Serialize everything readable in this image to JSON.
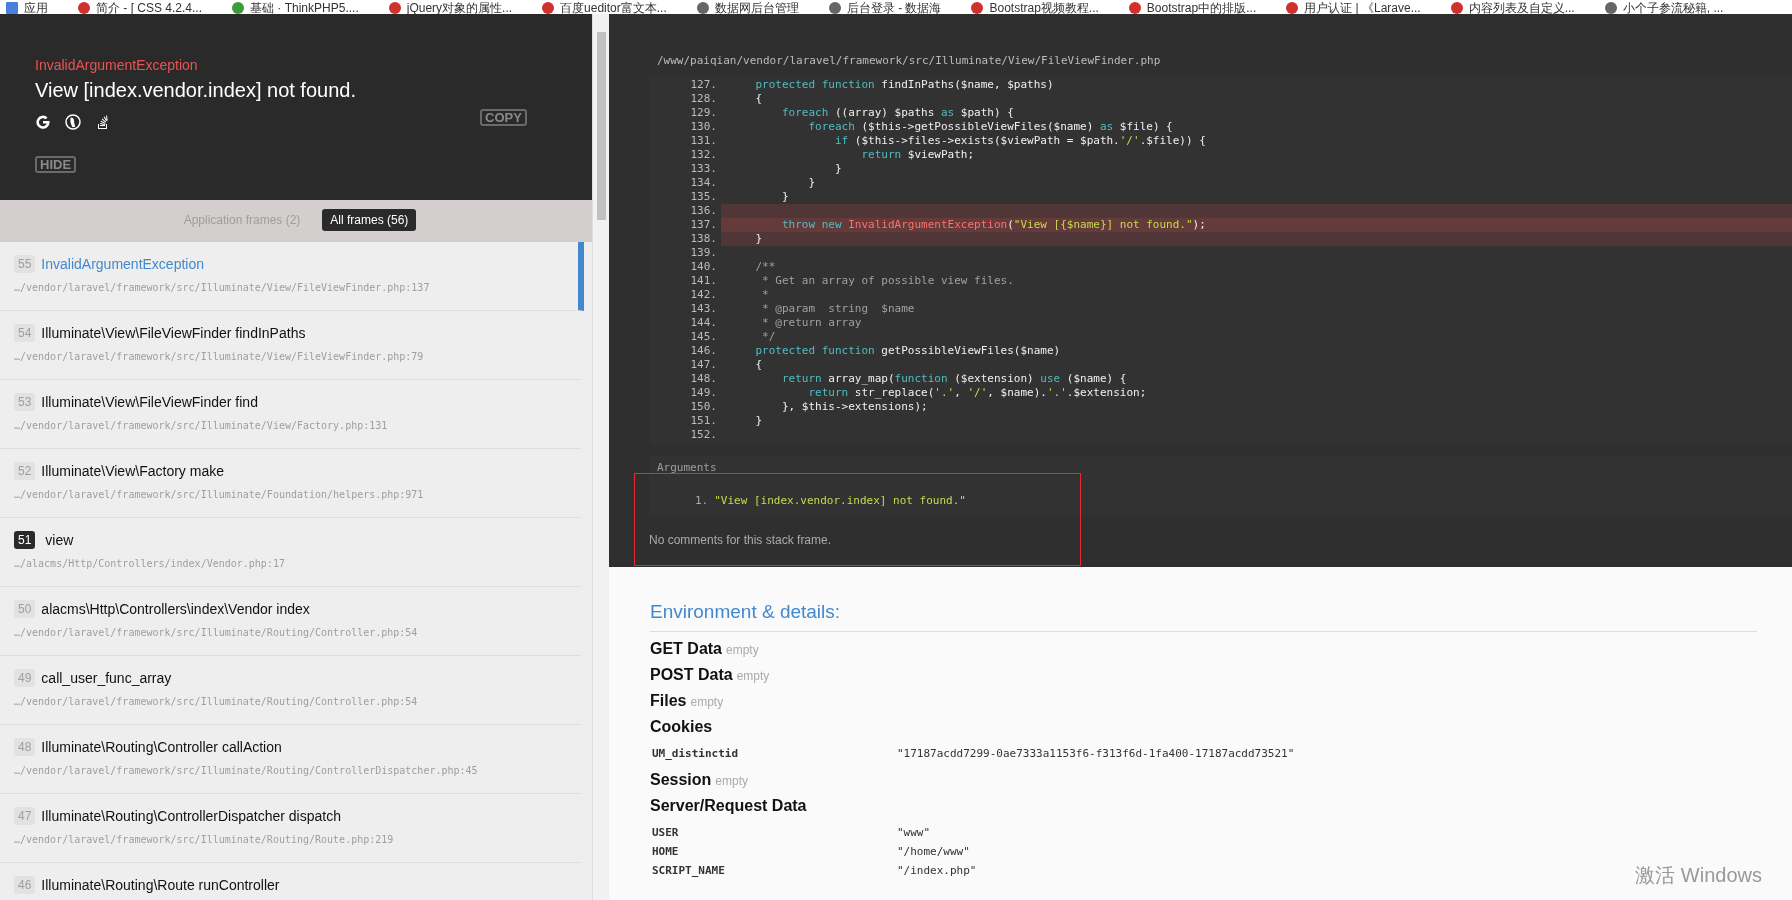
{
  "bookmarks": [
    {
      "label": "应用"
    },
    {
      "label": "简介 - [ CSS 4.2.4..."
    },
    {
      "label": "基础 · ThinkPHP5...."
    },
    {
      "label": "jQuery对象的属性..."
    },
    {
      "label": "百度ueditor富文本..."
    },
    {
      "label": "数据网后台管理"
    },
    {
      "label": "后台登录 - 数据海"
    },
    {
      "label": "Bootstrap视频教程..."
    },
    {
      "label": "Bootstrap中的排版..."
    },
    {
      "label": "用户认证 | 《Larave..."
    },
    {
      "label": "内容列表及自定义..."
    },
    {
      "label": "小个子参流秘籍, ..."
    }
  ],
  "exception": {
    "class": "InvalidArgumentException",
    "message": "View [index.vendor.index] not found.",
    "copy_label": "COPY",
    "hide_label": "HIDE"
  },
  "frame_tabs": [
    {
      "label": "Application frames (2)",
      "selected": false
    },
    {
      "label": "All frames (56)",
      "selected": true
    }
  ],
  "frames": [
    {
      "index": "55",
      "title": "InvalidArgumentException",
      "path": "…/vendor/laravel/framework/src/Illuminate/View/FileViewFinder.php:137",
      "selected": true,
      "application": false
    },
    {
      "index": "54",
      "title": "Illuminate\\View\\FileViewFinder findInPaths",
      "path": "…/vendor/laravel/framework/src/Illuminate/View/FileViewFinder.php:79",
      "selected": false,
      "application": false
    },
    {
      "index": "53",
      "title": "Illuminate\\View\\FileViewFinder find",
      "path": "…/vendor/laravel/framework/src/Illuminate/View/Factory.php:131",
      "selected": false,
      "application": false
    },
    {
      "index": "52",
      "title": "Illuminate\\View\\Factory make",
      "path": "…/vendor/laravel/framework/src/Illuminate/Foundation/helpers.php:971",
      "selected": false,
      "application": false
    },
    {
      "index": "51",
      "title": "view",
      "path": "…/alacms/Http/Controllers/index/Vendor.php:17",
      "selected": false,
      "application": true
    },
    {
      "index": "50",
      "title": "alacms\\Http\\Controllers\\index\\Vendor index",
      "path": "…/vendor/laravel/framework/src/Illuminate/Routing/Controller.php:54",
      "selected": false,
      "application": false
    },
    {
      "index": "49",
      "title": "call_user_func_array",
      "path": "…/vendor/laravel/framework/src/Illuminate/Routing/Controller.php:54",
      "selected": false,
      "application": false
    },
    {
      "index": "48",
      "title": "Illuminate\\Routing\\Controller callAction",
      "path": "…/vendor/laravel/framework/src/Illuminate/Routing/ControllerDispatcher.php:45",
      "selected": false,
      "application": false
    },
    {
      "index": "47",
      "title": "Illuminate\\Routing\\ControllerDispatcher dispatch",
      "path": "…/vendor/laravel/framework/src/Illuminate/Routing/Route.php:219",
      "selected": false,
      "application": false
    },
    {
      "index": "46",
      "title": "Illuminate\\Routing\\Route runController",
      "selected": false,
      "application": false
    }
  ],
  "code": {
    "file": "/www/paiqian/vendor/laravel/framework/src/Illuminate/View/FileViewFinder.php",
    "lines": [
      {
        "number": "127.",
        "highlighted": false,
        "error": false,
        "tokens": [
          {
            "kind": "kw",
            "text": "    protected function"
          },
          {
            "kind": "plain",
            "text": " findInPaths($name, $paths)"
          }
        ]
      },
      {
        "number": "128.",
        "highlighted": false,
        "error": false,
        "tokens": [
          {
            "kind": "plain",
            "text": "    {"
          }
        ]
      },
      {
        "number": "129.",
        "highlighted": false,
        "error": false,
        "tokens": [
          {
            "kind": "kw",
            "text": "        foreach"
          },
          {
            "kind": "plain",
            "text": " ((array) $paths "
          },
          {
            "kind": "kw",
            "text": "as"
          },
          {
            "kind": "plain",
            "text": " $path) {"
          }
        ]
      },
      {
        "number": "130.",
        "highlighted": false,
        "error": false,
        "tokens": [
          {
            "kind": "kw",
            "text": "            foreach"
          },
          {
            "kind": "plain",
            "text": " ($this->getPossibleViewFiles($name) "
          },
          {
            "kind": "kw",
            "text": "as"
          },
          {
            "kind": "plain",
            "text": " $file) {"
          }
        ]
      },
      {
        "number": "131.",
        "highlighted": false,
        "error": false,
        "tokens": [
          {
            "kind": "kw",
            "text": "                if"
          },
          {
            "kind": "plain",
            "text": " ($this->files->exists($viewPath = $path."
          },
          {
            "kind": "str",
            "text": "'/'"
          },
          {
            "kind": "plain",
            "text": ".$file)) {"
          }
        ]
      },
      {
        "number": "132.",
        "highlighted": false,
        "error": false,
        "tokens": [
          {
            "kind": "kw",
            "text": "                    return"
          },
          {
            "kind": "plain",
            "text": " $viewPath;"
          }
        ]
      },
      {
        "number": "133.",
        "highlighted": false,
        "error": false,
        "tokens": [
          {
            "kind": "plain",
            "text": "                }"
          }
        ]
      },
      {
        "number": "134.",
        "highlighted": false,
        "error": false,
        "tokens": [
          {
            "kind": "plain",
            "text": "            }"
          }
        ]
      },
      {
        "number": "135.",
        "highlighted": false,
        "error": false,
        "tokens": [
          {
            "kind": "plain",
            "text": "        }"
          }
        ]
      },
      {
        "number": "136.",
        "highlighted": true,
        "error": false
      },
      {
        "number": "137.",
        "highlighted": true,
        "error": true,
        "tokens": [
          {
            "kind": "kw",
            "text": "        throw new"
          },
          {
            "kind": "cls",
            "text": " InvalidArgumentException"
          },
          {
            "kind": "plain",
            "text": "("
          },
          {
            "kind": "str",
            "text": "\"View [{$name}] not found.\""
          },
          {
            "kind": "plain",
            "text": ");"
          }
        ]
      },
      {
        "number": "138.",
        "highlighted": true,
        "error": false,
        "tokens": [
          {
            "kind": "plain",
            "text": "    }"
          }
        ]
      },
      {
        "number": "139.",
        "highlighted": false,
        "error": false
      },
      {
        "number": "140.",
        "highlighted": false,
        "error": false,
        "tokens": [
          {
            "kind": "cmt",
            "text": "    /**"
          }
        ]
      },
      {
        "number": "141.",
        "highlighted": false,
        "error": false,
        "tokens": [
          {
            "kind": "cmt",
            "text": "     * Get an array of possible view files."
          }
        ]
      },
      {
        "number": "142.",
        "highlighted": false,
        "error": false,
        "tokens": [
          {
            "kind": "cmt",
            "text": "     *"
          }
        ]
      },
      {
        "number": "143.",
        "highlighted": false,
        "error": false,
        "tokens": [
          {
            "kind": "cmt",
            "text": "     * @param  string  $name"
          }
        ]
      },
      {
        "number": "144.",
        "highlighted": false,
        "error": false,
        "tokens": [
          {
            "kind": "cmt",
            "text": "     * @return array"
          }
        ]
      },
      {
        "number": "145.",
        "highlighted": false,
        "error": false,
        "tokens": [
          {
            "kind": "cmt",
            "text": "     */"
          }
        ]
      },
      {
        "number": "146.",
        "highlighted": false,
        "error": false,
        "tokens": [
          {
            "kind": "kw",
            "text": "    protected function"
          },
          {
            "kind": "plain",
            "text": " getPossibleViewFiles($name)"
          }
        ]
      },
      {
        "number": "147.",
        "highlighted": false,
        "error": false,
        "tokens": [
          {
            "kind": "plain",
            "text": "    {"
          }
        ]
      },
      {
        "number": "148.",
        "highlighted": false,
        "error": false,
        "tokens": [
          {
            "kind": "kw",
            "text": "        return"
          },
          {
            "kind": "plain",
            "text": " array_map("
          },
          {
            "kind": "kw",
            "text": "function"
          },
          {
            "kind": "plain",
            "text": " ($extension) "
          },
          {
            "kind": "kw",
            "text": "use"
          },
          {
            "kind": "plain",
            "text": " ($name) {"
          }
        ]
      },
      {
        "number": "149.",
        "highlighted": false,
        "error": false,
        "tokens": [
          {
            "kind": "kw",
            "text": "            return"
          },
          {
            "kind": "plain",
            "text": " str_replace("
          },
          {
            "kind": "str",
            "text": "'.'"
          },
          {
            "kind": "plain",
            "text": ", "
          },
          {
            "kind": "str",
            "text": "'/'"
          },
          {
            "kind": "plain",
            "text": ", $name)."
          },
          {
            "kind": "str",
            "text": "'.'"
          },
          {
            "kind": "plain",
            "text": ".$extension;"
          }
        ]
      },
      {
        "number": "150.",
        "highlighted": false,
        "error": false,
        "tokens": [
          {
            "kind": "plain",
            "text": "        }, $this->extensions);"
          }
        ]
      },
      {
        "number": "151.",
        "highlighted": false,
        "error": false,
        "tokens": [
          {
            "kind": "plain",
            "text": "    }"
          }
        ]
      },
      {
        "number": "152.",
        "highlighted": false,
        "error": false
      }
    ]
  },
  "arguments": {
    "title": "Arguments",
    "items": [
      {
        "number": "1.",
        "value": "\"View [index.vendor.index] not found.\""
      }
    ]
  },
  "comments_note": "No comments for this stack frame.",
  "environment": {
    "title": "Environment & details:",
    "sections": [
      {
        "title": "GET Data",
        "empty_label": "empty"
      },
      {
        "title": "POST Data",
        "empty_label": "empty"
      },
      {
        "title": "Files",
        "empty_label": "empty"
      },
      {
        "title": "Cookies",
        "rows": [
          {
            "key": "UM_distinctid",
            "value": "\"17187acdd7299-0ae7333a1153f6-f313f6d-1fa400-17187acdd73521\""
          }
        ]
      },
      {
        "title": "Session",
        "empty_label": "empty"
      },
      {
        "title": "Server/Request Data",
        "rows": [
          {
            "key": "USER",
            "value": "\"www\""
          },
          {
            "key": "HOME",
            "value": "\"/home/www\""
          },
          {
            "key": "SCRIPT_NAME",
            "value": "\"/index.php\""
          }
        ]
      }
    ]
  },
  "os_notice": "激活 Windows"
}
